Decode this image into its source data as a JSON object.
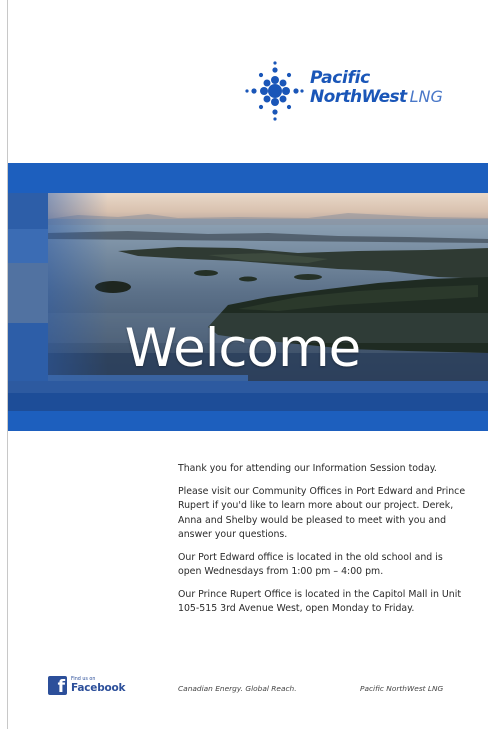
{
  "logo": {
    "line1": "Pacific",
    "line2": "NorthWest",
    "suffix": "LNG"
  },
  "banner": {
    "heading": "Welcome"
  },
  "body": {
    "paragraphs": [
      "Thank you for attending our Information Session today.",
      "Please visit our Community Offices in Port Edward and Prince Rupert if you'd like to learn more about our project. Derek, Anna and Shelby would be pleased to meet with you and answer your questions.",
      "Our Port Edward office is located in the old school and is open Wednesdays from 1:00 pm – 4:00 pm.",
      "Our Prince Rupert Office is located in the Capitol Mall in Unit 105-515 3rd Avenue West, open Monday to Friday."
    ]
  },
  "footer": {
    "facebook_small": "Find us on",
    "facebook_large": "Facebook",
    "tagline": "Canadian Energy. Global Reach.",
    "brand": "Pacific NorthWest LNG"
  },
  "colors": {
    "brand_blue": "#1d5fbe",
    "logo_blue": "#1a56b8",
    "facebook_blue": "#2c4f9a"
  },
  "icons": {
    "logo_mark": "dot-cluster-icon",
    "facebook": "facebook-icon"
  }
}
